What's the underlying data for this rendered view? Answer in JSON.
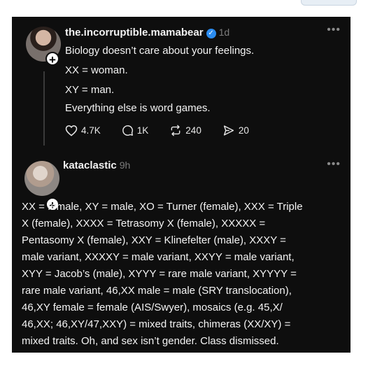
{
  "post1": {
    "username": "the.incorruptible.mamabear",
    "time": "1d",
    "lines": [
      "Biology doesn’t care about your feelings.",
      "XX = woman.",
      "XY = man.",
      "Everything else is word games."
    ],
    "likes": "4.7K",
    "replies": "1K",
    "reposts": "240",
    "shares": "20"
  },
  "post2": {
    "username": "kataclastic",
    "time": "9h",
    "lines": [
      "XX = female, XY = male, XO = Turner (female), XXX = Triple",
      "X (female), XXXX = Tetrasomy X (female), XXXXX =",
      "Pentasomy X (female), XXY = Klinefelter (male), XXXY =",
      "male variant, XXXXY = male variant, XXYY = male variant,",
      "XYY = Jacob’s (male), XYYY = rare male variant, XYYYY =",
      "rare male variant, 46,XX male = male (SRY translocation),",
      "46,XY female = female (AIS/Swyer), mosaics (e.g. 45,X/",
      "46,XX; 46,XY/47,XXY) = mixed traits, chimeras (XX/XY) =",
      "mixed traits. Oh, and sex isn’t gender. Class dismissed."
    ]
  },
  "icons": {
    "more": "•••",
    "plus": "+",
    "check": "✓"
  }
}
